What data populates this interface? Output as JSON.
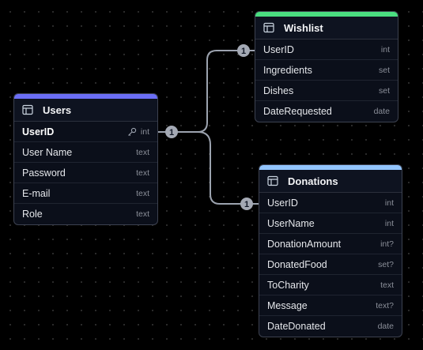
{
  "canvas": {
    "background": "#000000",
    "dot_color": "#2e2e2e",
    "edge_color": "#9ca3af"
  },
  "tables": {
    "users": {
      "title": "Users",
      "accent": "#6b6ef5",
      "fields": [
        {
          "name": "UserID",
          "type": "int",
          "primary": true
        },
        {
          "name": "User Name",
          "type": "text"
        },
        {
          "name": "Password",
          "type": "text"
        },
        {
          "name": "E-mail",
          "type": "text"
        },
        {
          "name": "Role",
          "type": "text"
        }
      ]
    },
    "wishlist": {
      "title": "Wishlist",
      "accent": "#4ade80",
      "fields": [
        {
          "name": "UserID",
          "type": "int"
        },
        {
          "name": "Ingredients",
          "type": "set"
        },
        {
          "name": "Dishes",
          "type": "set"
        },
        {
          "name": "DateRequested",
          "type": "date"
        }
      ]
    },
    "donations": {
      "title": "Donations",
      "accent": "#93c5fd",
      "fields": [
        {
          "name": "UserID",
          "type": "int"
        },
        {
          "name": "UserName",
          "type": "int"
        },
        {
          "name": "DonationAmount",
          "type": "int?"
        },
        {
          "name": "DonatedFood",
          "type": "set?"
        },
        {
          "name": "ToCharity",
          "type": "text"
        },
        {
          "name": "Message",
          "type": "text?"
        },
        {
          "name": "DateDonated",
          "type": "date"
        }
      ]
    }
  },
  "relations": [
    {
      "from": "Users.UserID",
      "to": "Wishlist.UserID",
      "from_label": "1",
      "to_label": "1"
    },
    {
      "from": "Users.UserID",
      "to": "Donations.UserID",
      "from_label": "1",
      "to_label": "1"
    }
  ]
}
